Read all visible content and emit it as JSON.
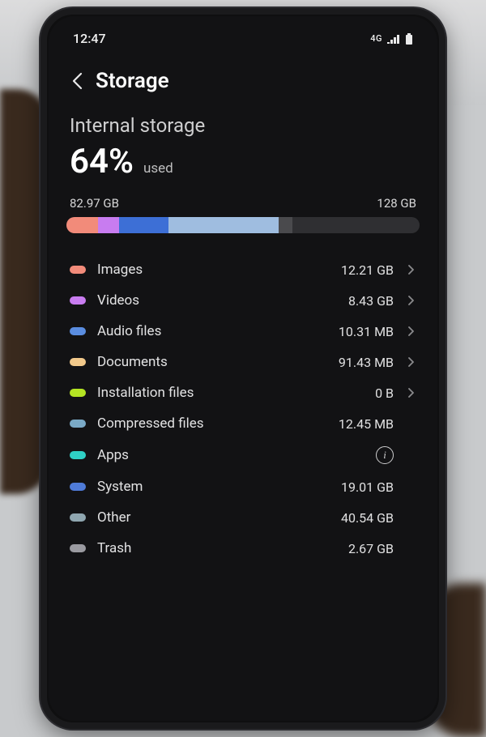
{
  "status": {
    "time": "12:47",
    "network_label": "4G"
  },
  "header": {
    "title": "Storage"
  },
  "storage": {
    "section": "Internal storage",
    "percent": "64%",
    "used_label": "used",
    "used_amount": "82.97 GB",
    "total_amount": "128 GB"
  },
  "segments": [
    {
      "color": "#f28b7a",
      "pct": 9
    },
    {
      "color": "#c87cf0",
      "pct": 6
    },
    {
      "color": "#3d6fd6",
      "pct": 14
    },
    {
      "color": "#9fbde0",
      "pct": 31
    },
    {
      "color": "#4a4a4d",
      "pct": 4
    }
  ],
  "categories": [
    {
      "label": "Images",
      "value": "12.21 GB",
      "color": "#f28b7a",
      "chevron": true,
      "info": false
    },
    {
      "label": "Videos",
      "value": "8.43 GB",
      "color": "#c87cf0",
      "chevron": true,
      "info": false
    },
    {
      "label": "Audio files",
      "value": "10.31 MB",
      "color": "#5a8de0",
      "chevron": true,
      "info": false
    },
    {
      "label": "Documents",
      "value": "91.43 MB",
      "color": "#f2c98b",
      "chevron": true,
      "info": false
    },
    {
      "label": "Installation files",
      "value": "0 B",
      "color": "#b4e423",
      "chevron": true,
      "info": false
    },
    {
      "label": "Compressed files",
      "value": "12.45 MB",
      "color": "#7aa9c6",
      "chevron": false,
      "info": false
    },
    {
      "label": "Apps",
      "value": "",
      "color": "#2fd0c5",
      "chevron": false,
      "info": true
    },
    {
      "label": "System",
      "value": "19.01 GB",
      "color": "#4f7bd8",
      "chevron": false,
      "info": false
    },
    {
      "label": "Other",
      "value": "40.54 GB",
      "color": "#8fa6b0",
      "chevron": false,
      "info": false
    },
    {
      "label": "Trash",
      "value": "2.67 GB",
      "color": "#9a9aa0",
      "chevron": false,
      "info": false
    }
  ]
}
